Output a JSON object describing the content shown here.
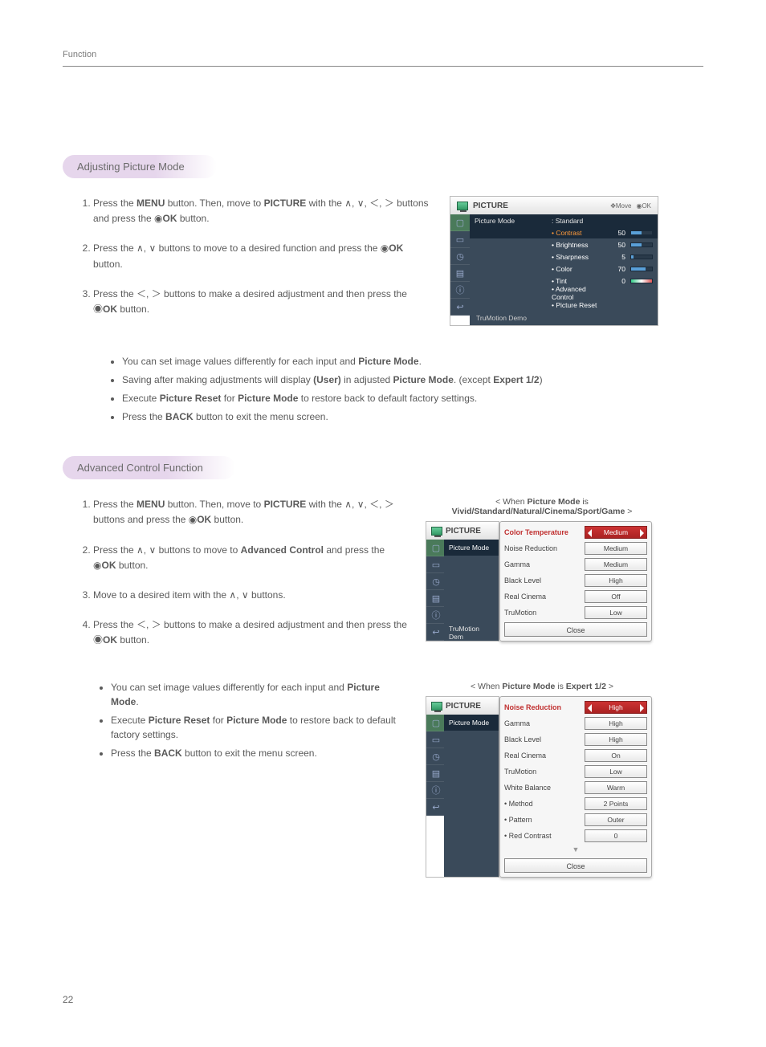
{
  "header": {
    "section": "Function",
    "page_number": "22"
  },
  "sections": {
    "adjusting": {
      "title": "Adjusting Picture Mode",
      "steps": [
        {
          "pre": "Press the ",
          "b1": "MENU",
          "mid": " button. Then, move to ",
          "b2": "PICTURE",
          "post": " with the ∧, ∨, ＜, ＞ buttons and press the ◉",
          "b3": "OK",
          "end": " button."
        },
        {
          "pre": "Press the ∧, ∨ buttons to move to a desired function and press the ◉",
          "b1": "OK",
          "end": " button."
        },
        {
          "pre": "Press the ＜, ＞ buttons to make a desired adjustment and then press the ◉",
          "b1": "OK",
          "end": " button."
        }
      ],
      "notes": [
        {
          "t1": "You can set image values differently for each input and ",
          "b": "Picture Mode",
          "t2": "."
        },
        {
          "t1": "Saving after making adjustments will display ",
          "b": "(User)",
          "t2": " in adjusted ",
          "b2": "Picture Mode",
          "t3": ". (except ",
          "b3": "Expert 1/2",
          "t4": ")"
        },
        {
          "t1": "Execute ",
          "b": "Picture Reset",
          "t2": " for ",
          "b2": "Picture Mode",
          "t3": " to restore back to default factory settings."
        },
        {
          "t1": "Press the ",
          "b": "BACK",
          "t2": " button to exit the menu screen."
        }
      ]
    },
    "advanced": {
      "title": "Advanced Control Function",
      "steps": [
        {
          "pre": "Press the ",
          "b1": "MENU",
          "mid": " button. Then, move to ",
          "b2": "PICTURE",
          "post": " with the ∧, ∨, ＜, ＞ buttons and press the ◉",
          "b3": "OK",
          "end": " button."
        },
        {
          "pre": "Press the ∧, ∨ buttons to move to ",
          "b1": "Advanced Control",
          "post": " and press the ◉",
          "b2": "OK",
          "end": " button."
        },
        {
          "pre": "Move to a desired item with the ∧, ∨ buttons."
        },
        {
          "pre": "Press the ＜, ＞ buttons to make a desired adjustment and then press the ◉",
          "b1": "OK",
          "end": " button."
        }
      ],
      "notes": [
        {
          "t1": "You can set image values differently for each input and ",
          "b": "Picture Mode",
          "t2": "."
        },
        {
          "t1": "Execute ",
          "b": "Picture Reset",
          "t2": " for ",
          "b2": "Picture Mode",
          "t3": " to restore back to default factory settings."
        },
        {
          "t1": "Press the ",
          "b": "BACK",
          "t2": " button to exit the menu screen."
        }
      ]
    }
  },
  "osd1": {
    "title": "PICTURE",
    "hint_move": "Move",
    "hint_ok": "OK",
    "picture_mode_label": "Picture Mode",
    "picture_mode_value": ": Standard",
    "rows": [
      {
        "label": "• Contrast",
        "value": "50",
        "fill": 50,
        "highlight": true
      },
      {
        "label": "• Brightness",
        "value": "50",
        "fill": 50
      },
      {
        "label": "• Sharpness",
        "value": "5",
        "fill": 10
      },
      {
        "label": "• Color",
        "value": "70",
        "fill": 70
      },
      {
        "label": "• Tint",
        "value": "0",
        "tint": true
      }
    ],
    "extra": [
      "• Advanced Control",
      "• Picture Reset"
    ],
    "footer": "TruMotion Demo"
  },
  "caption1": {
    "pre": "< When ",
    "b": "Picture Mode",
    "mid": " is ",
    "b2": "Vivid/Standard/Natural/Cinema/Sport/Game",
    "post": " >"
  },
  "caption2": {
    "pre": "< When ",
    "b": "Picture Mode",
    "mid": " is ",
    "b2": "Expert 1/2",
    "post": " >"
  },
  "adv_left": {
    "title": "PICTURE",
    "mode": "Picture Mode",
    "footer": "TruMotion Dem"
  },
  "adv_panel1": {
    "items": [
      {
        "label": "Color Temperature",
        "value": "Medium",
        "highlight": true,
        "selected": true
      },
      {
        "label": "Noise Reduction",
        "value": "Medium"
      },
      {
        "label": "Gamma",
        "value": "Medium"
      },
      {
        "label": "Black Level",
        "value": "High"
      },
      {
        "label": "Real Cinema",
        "value": "Off"
      },
      {
        "label": "TruMotion",
        "value": "Low"
      }
    ],
    "close": "Close"
  },
  "adv_panel2": {
    "items": [
      {
        "label": "Noise Reduction",
        "value": "High",
        "highlight": true,
        "selected": true
      },
      {
        "label": "Gamma",
        "value": "High"
      },
      {
        "label": "Black Level",
        "value": "High"
      },
      {
        "label": "Real Cinema",
        "value": "On"
      },
      {
        "label": "TruMotion",
        "value": "Low"
      },
      {
        "label": "White Balance",
        "value": "Warm"
      },
      {
        "label": "• Method",
        "value": "2 Points"
      },
      {
        "label": "• Pattern",
        "value": "Outer"
      },
      {
        "label": "• Red Contrast",
        "value": "0"
      }
    ],
    "close": "Close"
  }
}
